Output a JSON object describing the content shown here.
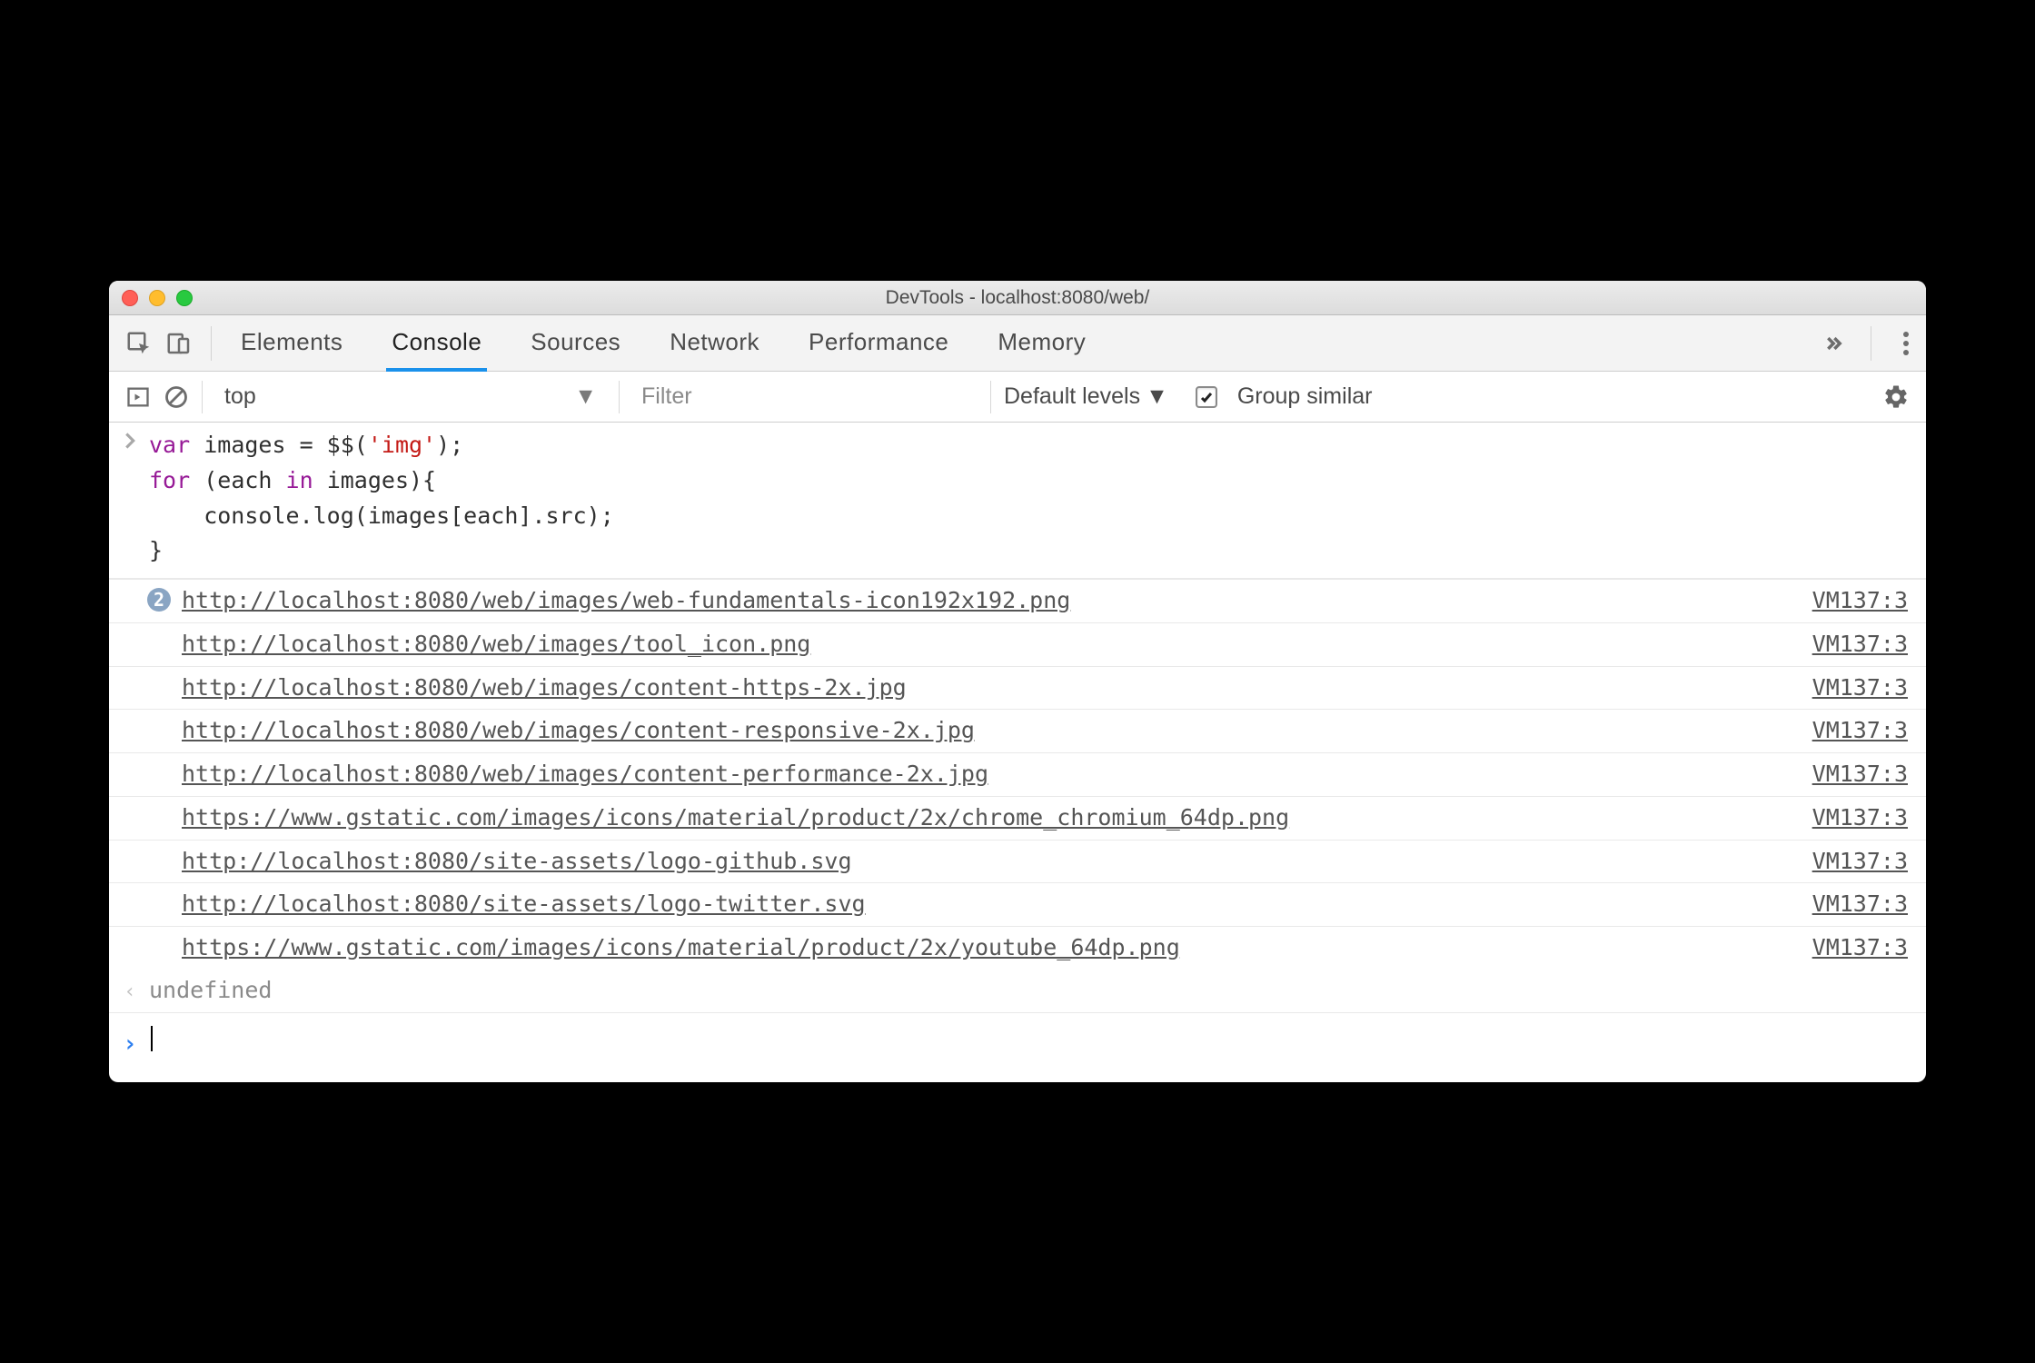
{
  "window": {
    "title": "DevTools - localhost:8080/web/"
  },
  "tabs": {
    "items": [
      "Elements",
      "Console",
      "Sources",
      "Network",
      "Performance",
      "Memory"
    ],
    "active": "Console"
  },
  "filterbar": {
    "context": "top",
    "filter_placeholder": "Filter",
    "levels_label": "Default levels",
    "group_similar_label": "Group similar",
    "group_similar_checked": true
  },
  "code_input": {
    "lines": [
      {
        "segments": [
          {
            "t": "var ",
            "c": "kw"
          },
          {
            "t": "images = $$(",
            "c": ""
          },
          {
            "t": "'img'",
            "c": "str"
          },
          {
            "t": ");",
            "c": ""
          }
        ]
      },
      {
        "segments": [
          {
            "t": "for ",
            "c": "kw"
          },
          {
            "t": "(each ",
            "c": ""
          },
          {
            "t": "in ",
            "c": "kw"
          },
          {
            "t": "images){",
            "c": ""
          }
        ]
      },
      {
        "segments": [
          {
            "t": "    console.log(images[each].src);",
            "c": ""
          }
        ]
      },
      {
        "segments": [
          {
            "t": "}",
            "c": ""
          }
        ]
      }
    ]
  },
  "log_entries": [
    {
      "badge": "2",
      "url": "http://localhost:8080/web/images/web-fundamentals-icon192x192.png",
      "src": "VM137:3"
    },
    {
      "badge": null,
      "url": "http://localhost:8080/web/images/tool_icon.png",
      "src": "VM137:3"
    },
    {
      "badge": null,
      "url": "http://localhost:8080/web/images/content-https-2x.jpg",
      "src": "VM137:3"
    },
    {
      "badge": null,
      "url": "http://localhost:8080/web/images/content-responsive-2x.jpg",
      "src": "VM137:3"
    },
    {
      "badge": null,
      "url": "http://localhost:8080/web/images/content-performance-2x.jpg",
      "src": "VM137:3"
    },
    {
      "badge": null,
      "url": "https://www.gstatic.com/images/icons/material/product/2x/chrome_chromium_64dp.png",
      "src": "VM137:3"
    },
    {
      "badge": null,
      "url": "http://localhost:8080/site-assets/logo-github.svg",
      "src": "VM137:3"
    },
    {
      "badge": null,
      "url": "http://localhost:8080/site-assets/logo-twitter.svg",
      "src": "VM137:3"
    },
    {
      "badge": null,
      "url": "https://www.gstatic.com/images/icons/material/product/2x/youtube_64dp.png",
      "src": "VM137:3"
    }
  ],
  "result": {
    "text": "undefined"
  }
}
